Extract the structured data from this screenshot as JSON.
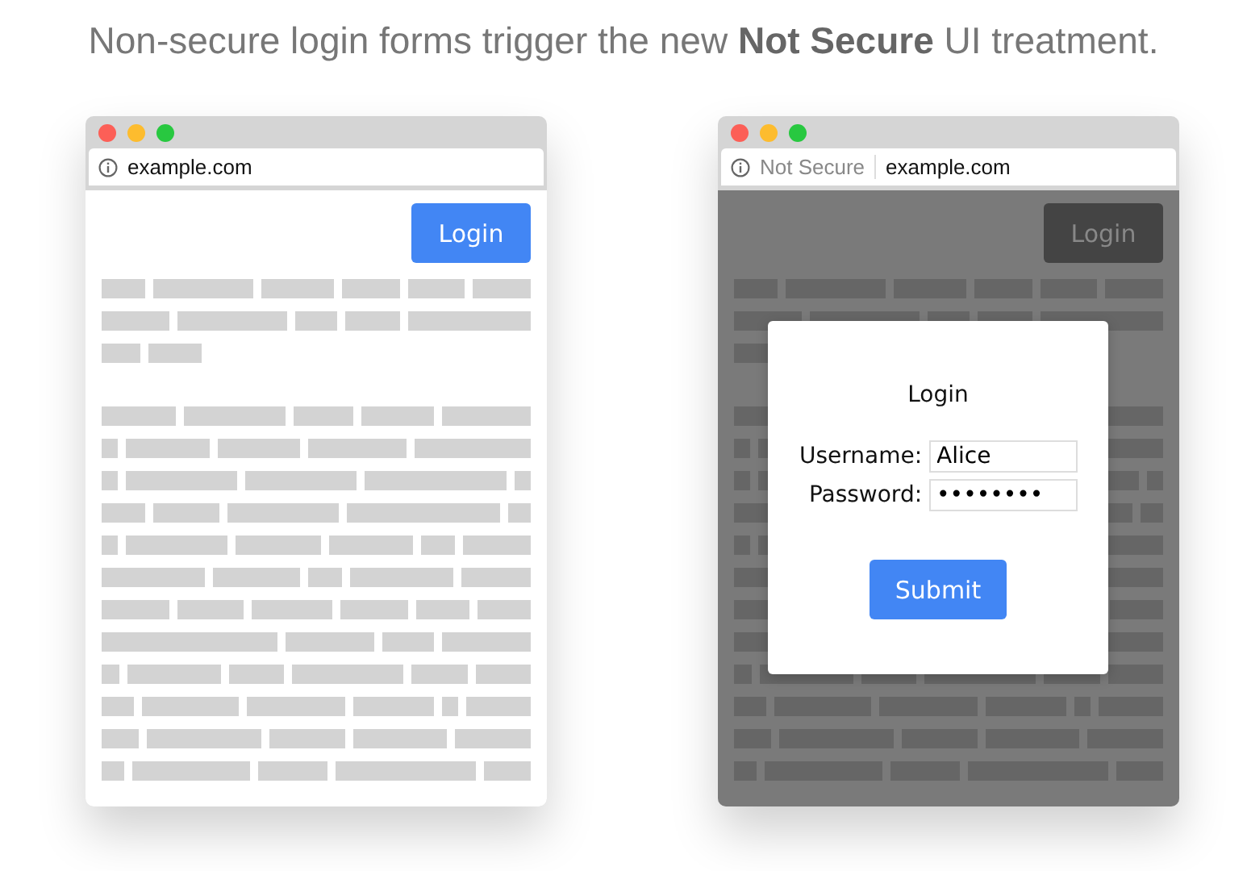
{
  "caption": "Non-secure login forms trigger the new **Not Secure** UI treatment.",
  "windows": [
    {
      "address": "example.com",
      "login_button": "Login",
      "dimmed": false
    },
    {
      "security_label": "Not Secure",
      "address": "example.com",
      "login_button": "Login",
      "dimmed": true,
      "dialog": {
        "title": "Login",
        "fields": [
          {
            "label": "Username:",
            "value": "Alice"
          },
          {
            "label": "Password:",
            "value": "••••••••"
          }
        ],
        "submit": "Submit"
      }
    }
  ]
}
